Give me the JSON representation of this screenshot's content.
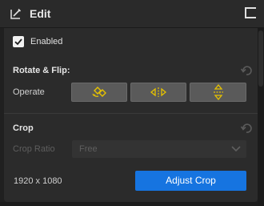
{
  "header": {
    "title": "Edit"
  },
  "enabled": {
    "label": "Enabled",
    "checked": true
  },
  "rotate_flip": {
    "title": "Rotate & Flip:",
    "operate_label": "Operate",
    "buttons": [
      {
        "name": "rotate",
        "icon": "rotate-icon"
      },
      {
        "name": "flip-horizontal",
        "icon": "flip-horizontal-icon"
      },
      {
        "name": "flip-vertical",
        "icon": "flip-vertical-icon"
      }
    ]
  },
  "crop": {
    "title": "Crop",
    "ratio_label": "Crop Ratio",
    "ratio_value": "Free",
    "dimensions": "1920 x 1080",
    "adjust_label": "Adjust Crop"
  },
  "colors": {
    "accent": "#1674e0",
    "icon_yellow": "#e6c200",
    "panel": "#2b2b2b",
    "background": "#202020"
  }
}
